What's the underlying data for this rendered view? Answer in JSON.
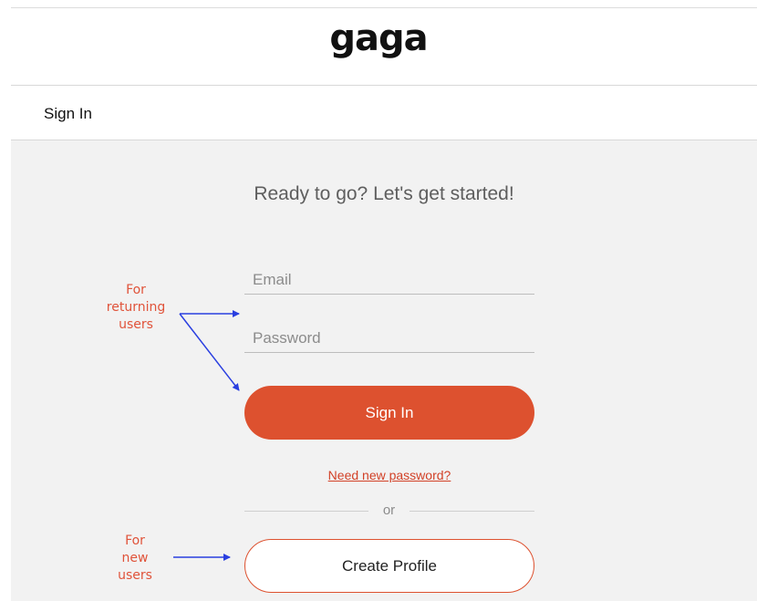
{
  "header": {
    "logo_text": "gaga",
    "page_heading": "Sign In"
  },
  "form": {
    "tagline": "Ready to go? Let's get started!",
    "email_placeholder": "Email",
    "password_placeholder": "Password",
    "signin_label": "Sign In",
    "forgot_label": "Need new password?",
    "divider_label": "or",
    "create_label": "Create Profile"
  },
  "annotations": {
    "returning": [
      "For",
      "returning",
      "users"
    ],
    "new_users": [
      "For",
      "new",
      "users"
    ]
  },
  "colors": {
    "brand_accent": "#dd512f",
    "panel_background": "#f2f2f2",
    "annotation_text": "#e0533a",
    "annotation_arrow": "#2a3fe0"
  }
}
